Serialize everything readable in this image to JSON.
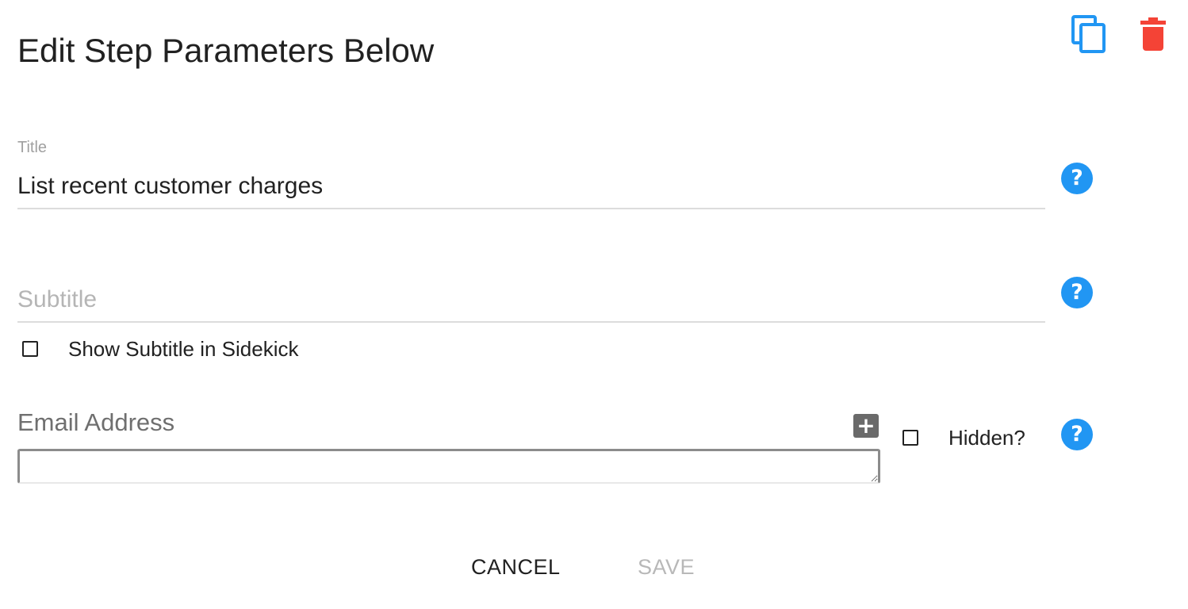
{
  "dialog": {
    "heading": "Edit Step Parameters Below"
  },
  "toolbar": {
    "copy_icon": "copy-icon",
    "delete_icon": "delete-icon",
    "copy_color": "#2196f3",
    "delete_color": "#f44336"
  },
  "title_field": {
    "label": "Title",
    "value": "List recent customer charges",
    "help": "?"
  },
  "subtitle_field": {
    "placeholder": "Subtitle",
    "value": "",
    "help": "?",
    "show_in_sidekick_label": "Show Subtitle in Sidekick",
    "show_in_sidekick_checked": false
  },
  "email_field": {
    "label": "Email Address",
    "add_symbol": "+",
    "value": "",
    "hidden_label": "Hidden?",
    "hidden_checked": false,
    "help": "?"
  },
  "actions": {
    "cancel_label": "CANCEL",
    "save_label": "SAVE",
    "save_enabled": false
  },
  "colors": {
    "accent": "#2196f3",
    "danger": "#f44336",
    "disabled_text": "#b8b8b8"
  }
}
